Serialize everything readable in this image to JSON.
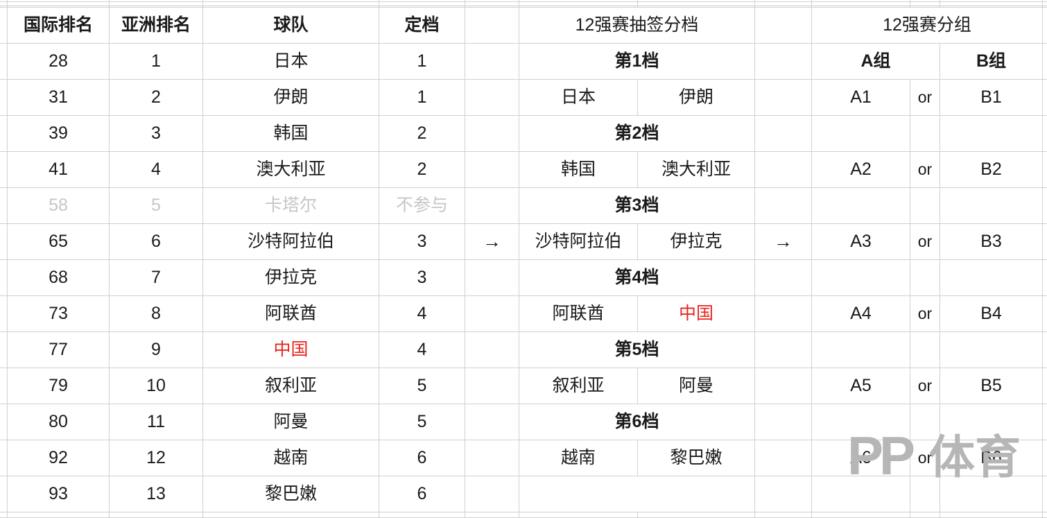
{
  "table": {
    "headers": {
      "intl_rank": "国际排名",
      "asia_rank": "亚洲排名",
      "team": "球队",
      "pot": "定档",
      "draw_pots_title": "12强赛抽签分档",
      "groups_title": "12强赛分组",
      "group_a": "A组",
      "group_b": "B组",
      "or_label": "or",
      "arrow": "→"
    },
    "ranking_rows": [
      {
        "intl_rank": "28",
        "asia_rank": "1",
        "team": "日本",
        "pot": "1",
        "muted": false,
        "accent": false
      },
      {
        "intl_rank": "31",
        "asia_rank": "2",
        "team": "伊朗",
        "pot": "1",
        "muted": false,
        "accent": false
      },
      {
        "intl_rank": "39",
        "asia_rank": "3",
        "team": "韩国",
        "pot": "2",
        "muted": false,
        "accent": false
      },
      {
        "intl_rank": "41",
        "asia_rank": "4",
        "team": "澳大利亚",
        "pot": "2",
        "muted": false,
        "accent": false
      },
      {
        "intl_rank": "58",
        "asia_rank": "5",
        "team": "卡塔尔",
        "pot": "不参与",
        "muted": true,
        "accent": false
      },
      {
        "intl_rank": "65",
        "asia_rank": "6",
        "team": "沙特阿拉伯",
        "pot": "3",
        "muted": false,
        "accent": false
      },
      {
        "intl_rank": "68",
        "asia_rank": "7",
        "team": "伊拉克",
        "pot": "3",
        "muted": false,
        "accent": false
      },
      {
        "intl_rank": "73",
        "asia_rank": "8",
        "team": "阿联酋",
        "pot": "4",
        "muted": false,
        "accent": false
      },
      {
        "intl_rank": "77",
        "asia_rank": "9",
        "team": "中国",
        "pot": "4",
        "muted": false,
        "accent": true
      },
      {
        "intl_rank": "79",
        "asia_rank": "10",
        "team": "叙利亚",
        "pot": "5",
        "muted": false,
        "accent": false
      },
      {
        "intl_rank": "80",
        "asia_rank": "11",
        "team": "阿曼",
        "pot": "5",
        "muted": false,
        "accent": false
      },
      {
        "intl_rank": "92",
        "asia_rank": "12",
        "team": "越南",
        "pot": "6",
        "muted": false,
        "accent": false
      },
      {
        "intl_rank": "93",
        "asia_rank": "13",
        "team": "黎巴嫩",
        "pot": "6",
        "muted": false,
        "accent": false
      }
    ],
    "pots": [
      {
        "label": "第1档",
        "left_team": "日本",
        "right_team": "伊朗",
        "left_accent": false,
        "right_accent": false
      },
      {
        "label": "第2档",
        "left_team": "韩国",
        "right_team": "澳大利亚",
        "left_accent": false,
        "right_accent": false
      },
      {
        "label": "第3档",
        "left_team": "沙特阿拉伯",
        "right_team": "伊拉克",
        "left_accent": false,
        "right_accent": false
      },
      {
        "label": "第4档",
        "left_team": "阿联酋",
        "right_team": "中国",
        "left_accent": false,
        "right_accent": true
      },
      {
        "label": "第5档",
        "left_team": "叙利亚",
        "right_team": "阿曼",
        "left_accent": false,
        "right_accent": false
      },
      {
        "label": "第6档",
        "left_team": "越南",
        "right_team": "黎巴嫩",
        "left_accent": false,
        "right_accent": false
      }
    ],
    "group_slots": [
      {
        "a": "A1",
        "or": "or",
        "b": "B1"
      },
      {
        "a": "A2",
        "or": "or",
        "b": "B2"
      },
      {
        "a": "A3",
        "or": "or",
        "b": "B3"
      },
      {
        "a": "A4",
        "or": "or",
        "b": "B4"
      },
      {
        "a": "A5",
        "or": "or",
        "b": "B5"
      },
      {
        "a": "A6",
        "or": "or",
        "b": "B6"
      }
    ],
    "arrows": {
      "left_arrow": "→",
      "right_arrow": "→"
    }
  },
  "watermark": {
    "brand_latin": "PP",
    "brand_cn": "体育",
    "color": "#b6b6b6"
  },
  "colors": {
    "grid": "#d0d0d0",
    "text": "#1a1a1a",
    "muted": "#c6c6c6",
    "accent": "#e8251d",
    "background": "#ffffff"
  }
}
